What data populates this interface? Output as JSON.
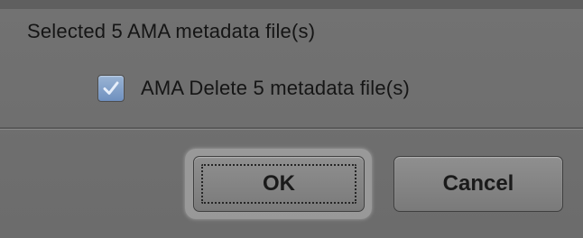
{
  "dialog": {
    "message": "Selected  5  AMA metadata file(s)",
    "option": {
      "label": "AMA  Delete  5  metadata file(s)",
      "checked": true
    },
    "buttons": {
      "ok_label": "OK",
      "cancel_label": "Cancel"
    },
    "colors": {
      "background": "#727272",
      "checkbox_fill": "#7f9dc8",
      "text": "#151515"
    }
  }
}
